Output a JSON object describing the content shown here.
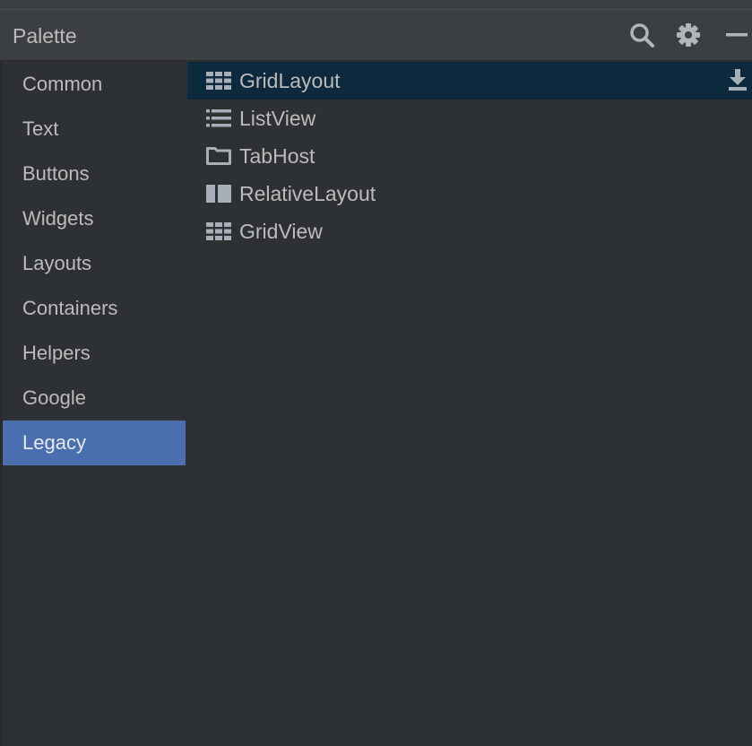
{
  "header": {
    "title": "Palette",
    "icons": [
      "search-icon",
      "gear-icon",
      "minimize-icon"
    ]
  },
  "categories": [
    {
      "label": "Common"
    },
    {
      "label": "Text"
    },
    {
      "label": "Buttons"
    },
    {
      "label": "Widgets"
    },
    {
      "label": "Layouts"
    },
    {
      "label": "Containers"
    },
    {
      "label": "Helpers"
    },
    {
      "label": "Google"
    },
    {
      "label": "Legacy",
      "selected": true
    }
  ],
  "components": [
    {
      "label": "GridLayout",
      "icon": "grid-icon",
      "selected": true,
      "action_icon": "download-icon"
    },
    {
      "label": "ListView",
      "icon": "list-icon"
    },
    {
      "label": "TabHost",
      "icon": "tab-host-icon"
    },
    {
      "label": "RelativeLayout",
      "icon": "relative-layout-icon"
    },
    {
      "label": "GridView",
      "icon": "grid-icon"
    }
  ],
  "colors": {
    "background": "#2e3133",
    "header_background": "#3c3f41",
    "selected_category": "#4b6eaf",
    "selected_component": "#0d293e",
    "text": "#bbbbbb",
    "icon": "#a7b0b8"
  }
}
